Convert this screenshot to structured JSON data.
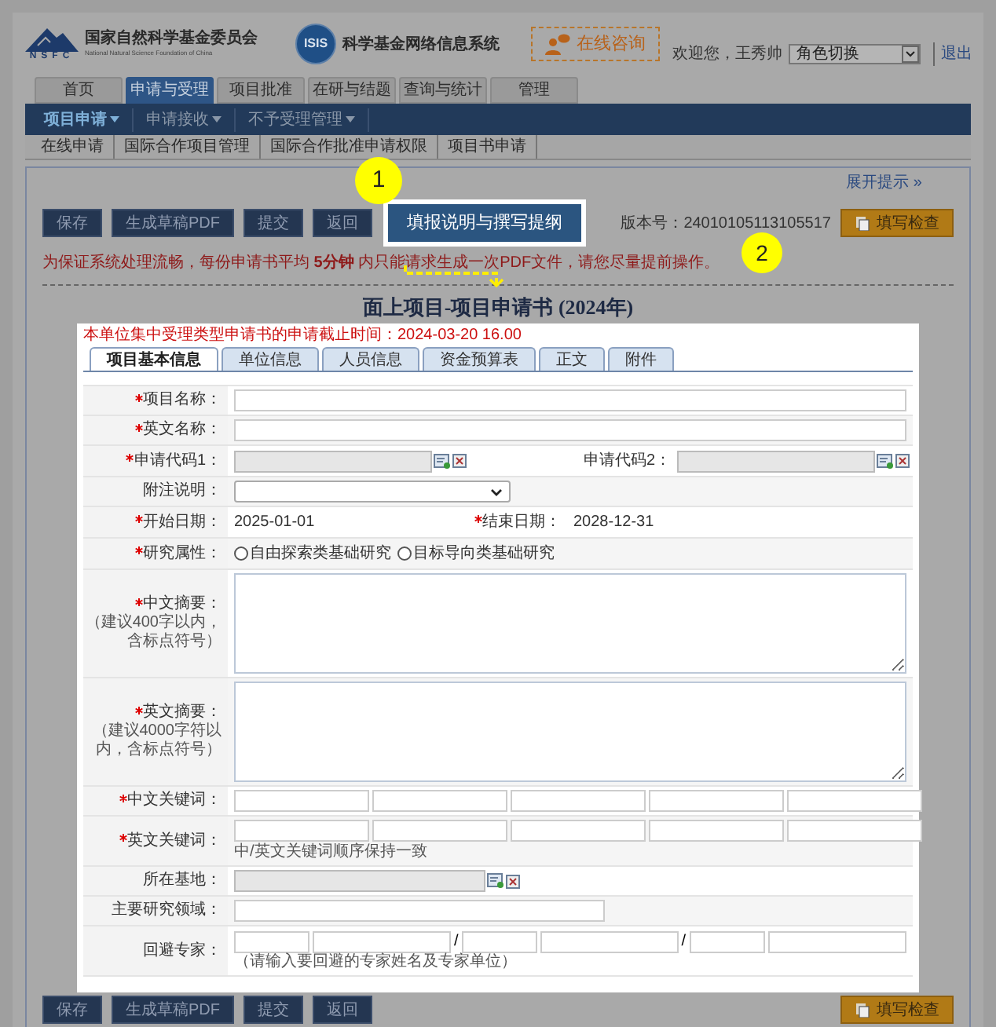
{
  "header": {
    "logo_text": "NSFC",
    "org_name": "国家自然科学基金委员会",
    "org_name_en": "National Natural Science Foundation of China",
    "system_logo_text": "ISIS",
    "system_name": "科学基金网络信息系统",
    "consult_button": "在线咨询",
    "welcome": "欢迎您，王秀帅",
    "role_select": "角色切换",
    "logout": "退出"
  },
  "main_tabs": [
    {
      "label": "首页",
      "selected": false
    },
    {
      "label": "申请与受理",
      "selected": true
    },
    {
      "label": "项目批准",
      "selected": false
    },
    {
      "label": "在研与结题",
      "selected": false
    },
    {
      "label": "查询与统计",
      "selected": false
    },
    {
      "label": "管理",
      "selected": false
    }
  ],
  "sub_nav": [
    {
      "label": "项目申请",
      "selected": true
    },
    {
      "label": "申请接收",
      "selected": false
    },
    {
      "label": "不予受理管理",
      "selected": false
    }
  ],
  "links": [
    "在线申请",
    "国际合作项目管理",
    "国际合作批准申请权限",
    "项目书申请"
  ],
  "expand_hint": "展开提示 »",
  "toolbar": {
    "buttons": [
      {
        "label": "保存",
        "highlighted": false
      },
      {
        "label": "生成草稿PDF",
        "highlighted": false
      },
      {
        "label": "提交",
        "highlighted": false
      },
      {
        "label": "返回",
        "highlighted": false
      },
      {
        "label": "填报说明与撰写提纲",
        "highlighted": true
      }
    ],
    "version": "版本号：24010105113105517",
    "check_button": "填写检查"
  },
  "notice": "为保证系统处理流畅，每份申请书平均 **5分钟** 内只能请求生成一次PDF文件，请您尽量提前操作。",
  "title": "面上项目-项目申请书 (2024年)",
  "form": {
    "deadline": "本单位集中受理类型申请书的申请截止时间：2024-03-20 16.00",
    "tabs": [
      {
        "label": "项目基本信息",
        "selected": true
      },
      {
        "label": "单位信息",
        "selected": false
      },
      {
        "label": "人员信息",
        "selected": false
      },
      {
        "label": "资金预算表",
        "selected": false
      },
      {
        "label": "正文",
        "selected": false
      },
      {
        "label": "附件",
        "selected": false
      }
    ],
    "rows": [
      {
        "kind": "text",
        "label": "项目名称：",
        "required": true
      },
      {
        "kind": "text",
        "label": "英文名称：",
        "required": true
      },
      {
        "kind": "code_pair",
        "label": "申请代码1：",
        "required": true,
        "second_label": "申请代码2："
      },
      {
        "kind": "select",
        "label": "附注说明：",
        "required": false
      },
      {
        "kind": "dates",
        "label": "开始日期：",
        "required": true,
        "value": "2025-01-01",
        "second_label": "结束日期：",
        "second_value": "2028-12-31"
      },
      {
        "kind": "radio",
        "label": "研究属性：",
        "required": true,
        "options": [
          {
            "label": "自由探索类基础研究",
            "selected": false
          },
          {
            "label": "目标导向类基础研究",
            "selected": false
          }
        ]
      },
      {
        "kind": "textarea",
        "label": "中文摘要：",
        "required": true,
        "hint": "（建议400字以内，含标点符号）"
      },
      {
        "kind": "textarea",
        "label": "英文摘要：",
        "required": true,
        "hint": "（建议4000字符以内，含标点符号）"
      },
      {
        "kind": "keywords",
        "label": "中文关键词：",
        "required": true
      },
      {
        "kind": "keywords",
        "label": "英文关键词：",
        "required": true,
        "note": "中/英文关键词顺序保持一致"
      },
      {
        "kind": "picker",
        "label": "所在基地：",
        "required": false
      },
      {
        "kind": "short_text",
        "label": "主要研究领域：",
        "required": false
      },
      {
        "kind": "experts",
        "label": "回避专家：",
        "required": false,
        "separator": "/",
        "note": "（请输入要回避的专家姓名及专家单位）"
      }
    ]
  },
  "bottom_toolbar": {
    "buttons": [
      "保存",
      "生成草稿PDF",
      "提交",
      "返回"
    ],
    "check_button": "填写检查"
  },
  "annotations": [
    "1",
    "2"
  ]
}
